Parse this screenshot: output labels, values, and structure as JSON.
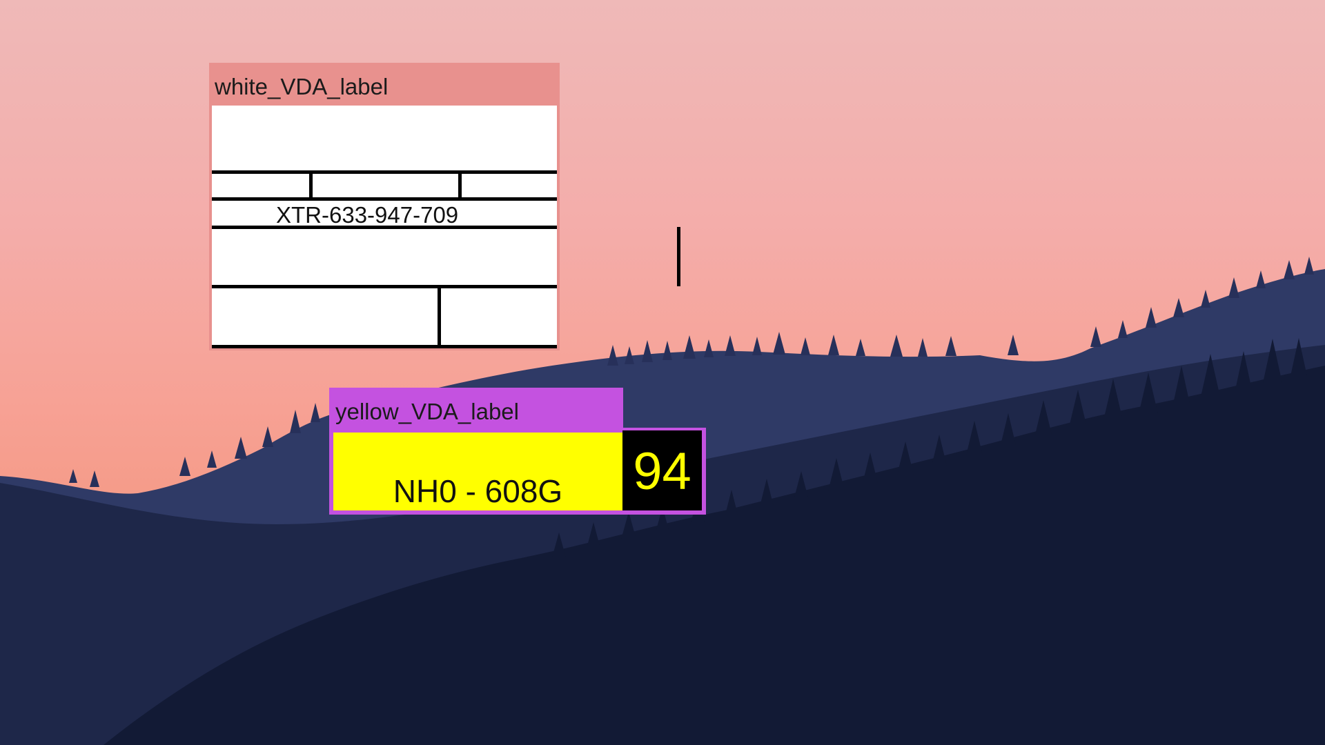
{
  "desktop": {
    "wallpaper": "mountain-sunset-wallpaper"
  },
  "white_window": {
    "title": "white_VDA_label",
    "code": "XTR-633-947-709",
    "titlebar_color": "#e8918e"
  },
  "yellow_window": {
    "title": "yellow_VDA_label",
    "plate": "NH0 - 608G",
    "number": "94",
    "titlebar_color": "#c452e0",
    "panel_color": "#ffff00"
  }
}
